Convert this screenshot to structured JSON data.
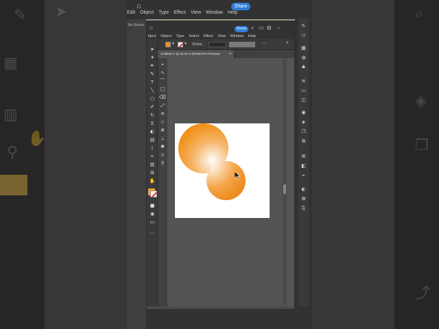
{
  "background": {
    "menu_items": [
      "Edit",
      "Object",
      "Type",
      "Effect",
      "View",
      "Window",
      "Help"
    ],
    "share_label": "Share",
    "left_strip_label": "No Selecti"
  },
  "window": {
    "menu_items": [
      "bject",
      "Object",
      "Type",
      "Select",
      "Effect",
      "View",
      "Window",
      "Help"
    ],
    "share_label": "Share",
    "control_bar": {
      "label": "ction",
      "stroke_label": "Stroke:"
    },
    "document_tab": {
      "title": "Untitled-1* @ 33.33 % (RGB/CPU Preview)",
      "close": "×"
    }
  },
  "artwork": {
    "artboard_color": "#ffffff",
    "gradient_colors": [
      "#ffffff",
      "#f2941f"
    ],
    "accent_orange": "#f0901f",
    "stroke_none_red": "#e02020"
  },
  "icons": {
    "home": "home-icon",
    "search": "search-icon",
    "arrange": "arrange-documents-icon",
    "cursor": "pointer-cursor-icon"
  }
}
